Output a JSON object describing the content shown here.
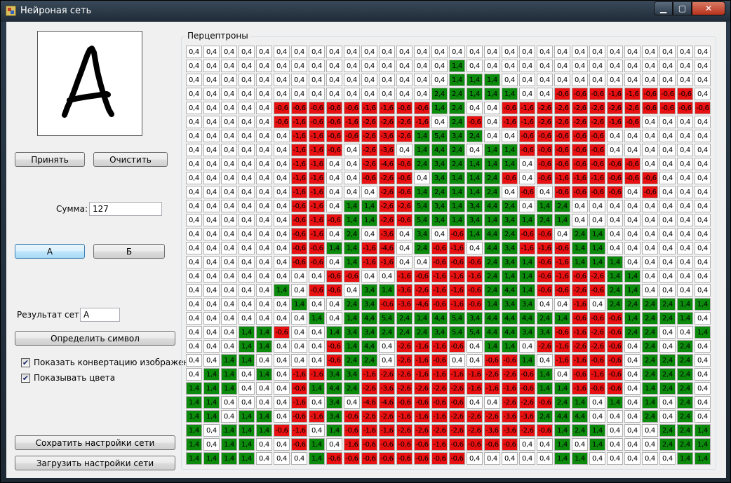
{
  "window": {
    "title": "Нейроная сеть"
  },
  "buttons": {
    "accept": "Принять",
    "clear": "Очистить",
    "letter_a": "А",
    "letter_b": "Б",
    "detect": "Определить символ",
    "save": "Сохратить настройки сети",
    "load": "Загрузить настройки сети"
  },
  "sum": {
    "label": "Сумма:",
    "value": "127"
  },
  "result": {
    "label": "Результат сети:",
    "value": "А"
  },
  "options": {
    "show_conversion": {
      "label": "Показать конвертацию изображения",
      "checked": true
    },
    "show_colors": {
      "label": "Показывать цвета",
      "checked": true
    }
  },
  "perceptrons": {
    "title": "Перцептроны",
    "colors": {
      "w": "#ffffff",
      "g": "#0b8a0b",
      "r": "#e81010"
    },
    "rows": [
      [
        "w:0,4",
        "w:0,4",
        "w:0,4",
        "w:0,4",
        "w:0,4",
        "w:0,4",
        "w:0,4",
        "w:0,4",
        "w:0,4",
        "w:0,4",
        "w:0,4",
        "w:0,4",
        "w:0,4",
        "w:0,4",
        "w:0,4",
        "w:0,4",
        "w:0,4",
        "w:0,4",
        "w:0,4",
        "w:0,4",
        "w:0,4",
        "w:0,4",
        "w:0,4",
        "w:0,4",
        "w:0,4",
        "w:0,4",
        "w:0,4",
        "w:0,4",
        "w:0,4",
        "w:0,4"
      ],
      [
        "w:0,4",
        "w:0,4",
        "w:0,4",
        "w:0,4",
        "w:0,4",
        "w:0,4",
        "w:0,4",
        "w:0,4",
        "w:0,4",
        "w:0,4",
        "w:0,4",
        "w:0,4",
        "w:0,4",
        "w:0,4",
        "w:0,4",
        "g:1,4",
        "w:0,4",
        "w:0,4",
        "w:0,4",
        "w:0,4",
        "w:0,4",
        "w:0,4",
        "w:0,4",
        "w:0,4",
        "w:0,4",
        "w:0,4",
        "w:0,4",
        "w:0,4",
        "w:0,4",
        "w:0,4"
      ],
      [
        "w:0,4",
        "w:0,4",
        "w:0,4",
        "w:0,4",
        "w:0,4",
        "w:0,4",
        "w:0,4",
        "w:0,4",
        "w:0,4",
        "w:0,4",
        "w:0,4",
        "w:0,4",
        "w:0,4",
        "w:0,4",
        "w:0,4",
        "g:1,4",
        "g:1,4",
        "g:1,4",
        "w:0,4",
        "w:0,4",
        "w:0,4",
        "w:0,4",
        "w:0,4",
        "w:0,4",
        "w:0,4",
        "w:0,4",
        "w:0,4",
        "w:0,4",
        "w:0,4",
        "w:0,4"
      ],
      [
        "w:0,4",
        "w:0,4",
        "w:0,4",
        "w:0,4",
        "w:0,4",
        "w:0,4",
        "w:0,4",
        "w:0,4",
        "w:0,4",
        "w:0,4",
        "w:0,4",
        "w:0,4",
        "w:0,4",
        "w:0,4",
        "g:2,4",
        "g:2,4",
        "g:1,4",
        "g:1,4",
        "g:1,4",
        "w:0,4",
        "w:0,4",
        "r:-0,6",
        "r:-0,6",
        "r:-0,6",
        "r:-1,6",
        "r:-1,6",
        "r:-0,6",
        "r:-0,6",
        "r:-0,6",
        "w:0,4"
      ],
      [
        "w:0,4",
        "w:0,4",
        "w:0,4",
        "w:0,4",
        "w:0,4",
        "r:-0,6",
        "r:-0,6",
        "r:-0,6",
        "r:-0,6",
        "r:-0,6",
        "r:-1,6",
        "r:-1,6",
        "r:-0,6",
        "r:-0,6",
        "g:1,4",
        "g:2,4",
        "w:0,4",
        "w:0,4",
        "r:-0,6",
        "r:-1,6",
        "r:-2,6",
        "r:-2,6",
        "r:-2,6",
        "r:-2,6",
        "r:-2,6",
        "r:-2,6",
        "r:-0,6",
        "r:-0,6",
        "r:-0,6",
        "r:-0,6"
      ],
      [
        "w:0,4",
        "w:0,4",
        "w:0,4",
        "w:0,4",
        "w:0,4",
        "r:-0,6",
        "r:-1,6",
        "r:-0,6",
        "r:-0,6",
        "r:-1,6",
        "r:-2,6",
        "r:-2,6",
        "r:-2,6",
        "r:-1,6",
        "w:0,4",
        "g:2,4",
        "r:-0,6",
        "w:0,4",
        "r:-1,6",
        "r:-1,6",
        "r:-2,6",
        "r:-2,6",
        "r:-2,6",
        "r:-2,6",
        "r:-1,6",
        "r:-0,6",
        "w:0,4",
        "w:0,4",
        "w:0,4",
        "w:0,4"
      ],
      [
        "w:0,4",
        "w:0,4",
        "w:0,4",
        "w:0,4",
        "w:0,4",
        "w:0,4",
        "r:-1,6",
        "r:-1,6",
        "r:-0,6",
        "r:-0,6",
        "r:-2,6",
        "r:-3,6",
        "r:-2,6",
        "g:1,4",
        "g:5,4",
        "g:3,4",
        "g:2,4",
        "w:0,4",
        "w:0,4",
        "r:-0,6",
        "r:-0,6",
        "r:-0,6",
        "r:-0,6",
        "r:-0,6",
        "w:0,4",
        "w:0,4",
        "w:0,4",
        "w:0,4",
        "w:0,4",
        "w:0,4"
      ],
      [
        "w:0,4",
        "w:0,4",
        "w:0,4",
        "w:0,4",
        "w:0,4",
        "w:0,4",
        "r:-1,6",
        "r:-1,6",
        "r:-0,6",
        "w:0,4",
        "r:-2,6",
        "r:-3,6",
        "w:0,4",
        "g:1,4",
        "g:4,4",
        "g:2,4",
        "w:0,4",
        "g:1,4",
        "g:1,4",
        "r:-0,6",
        "r:-0,6",
        "r:-0,6",
        "r:-0,6",
        "r:-0,6",
        "w:0,4",
        "w:0,4",
        "w:0,4",
        "w:0,4",
        "w:0,4",
        "w:0,4"
      ],
      [
        "w:0,4",
        "w:0,4",
        "w:0,4",
        "w:0,4",
        "w:0,4",
        "w:0,4",
        "r:-1,6",
        "r:-1,6",
        "w:0,4",
        "w:0,4",
        "r:-2,6",
        "r:-4,6",
        "r:-0,6",
        "g:2,4",
        "g:3,4",
        "g:2,4",
        "g:1,4",
        "g:1,4",
        "g:1,4",
        "w:0,4",
        "r:-0,6",
        "r:-0,6",
        "r:-0,6",
        "r:-0,6",
        "r:-0,6",
        "r:-0,6",
        "w:0,4",
        "w:0,4",
        "w:0,4",
        "w:0,4"
      ],
      [
        "w:0,4",
        "w:0,4",
        "w:0,4",
        "w:0,4",
        "w:0,4",
        "w:0,4",
        "r:-1,6",
        "r:-1,6",
        "w:0,4",
        "w:0,4",
        "r:-0,6",
        "r:-2,6",
        "r:-0,6",
        "w:0,4",
        "g:3,4",
        "g:1,4",
        "g:1,4",
        "g:2,4",
        "r:-0,6",
        "w:0,4",
        "r:-0,6",
        "r:-1,6",
        "r:-1,6",
        "r:-1,6",
        "r:-0,6",
        "r:-0,6",
        "r:-0,6",
        "w:0,4",
        "w:0,4",
        "w:0,4"
      ],
      [
        "w:0,4",
        "w:0,4",
        "w:0,4",
        "w:0,4",
        "w:0,4",
        "w:0,4",
        "r:-1,6",
        "r:-1,6",
        "w:0,4",
        "w:0,4",
        "w:0,4",
        "r:-2,6",
        "r:-0,6",
        "g:1,4",
        "g:2,4",
        "g:1,4",
        "g:1,4",
        "g:2,4",
        "w:0,4",
        "r:-0,6",
        "w:0,4",
        "r:-0,6",
        "r:-0,6",
        "r:-0,6",
        "r:-0,6",
        "w:0,4",
        "r:-0,6",
        "w:0,4",
        "w:0,4",
        "w:0,4"
      ],
      [
        "w:0,4",
        "w:0,4",
        "w:0,4",
        "w:0,4",
        "w:0,4",
        "w:0,4",
        "r:-0,6",
        "r:-1,6",
        "w:0,4",
        "g:1,4",
        "g:1,4",
        "r:-2,6",
        "r:-2,6",
        "g:5,4",
        "g:3,4",
        "g:1,4",
        "g:3,4",
        "g:4,4",
        "g:2,4",
        "w:0,4",
        "g:1,4",
        "g:2,4",
        "w:0,4",
        "w:0,4",
        "w:0,4",
        "w:0,4",
        "w:0,4",
        "w:0,4",
        "w:0,4",
        "w:0,4"
      ],
      [
        "w:0,4",
        "w:0,4",
        "w:0,4",
        "w:0,4",
        "w:0,4",
        "w:0,4",
        "r:-0,6",
        "r:-1,6",
        "r:-0,6",
        "g:1,4",
        "g:1,4",
        "r:-2,6",
        "r:-0,6",
        "g:5,4",
        "g:3,4",
        "g:1,4",
        "g:3,4",
        "g:1,4",
        "g:3,4",
        "g:1,4",
        "g:2,4",
        "g:1,4",
        "w:0,4",
        "w:0,4",
        "w:0,4",
        "w:0,4",
        "w:0,4",
        "w:0,4",
        "w:0,4",
        "w:0,4"
      ],
      [
        "w:0,4",
        "w:0,4",
        "w:0,4",
        "w:0,4",
        "w:0,4",
        "w:0,4",
        "r:-0,6",
        "r:-1,6",
        "w:0,4",
        "g:2,4",
        "w:0,4",
        "r:-3,6",
        "w:0,4",
        "g:3,4",
        "w:0,4",
        "r:-0,6",
        "g:1,4",
        "g:4,4",
        "g:2,4",
        "r:-0,6",
        "r:-0,6",
        "w:0,4",
        "g:2,4",
        "g:1,4",
        "w:0,4",
        "w:0,4",
        "w:0,4",
        "w:0,4",
        "w:0,4",
        "w:0,4"
      ],
      [
        "w:0,4",
        "w:0,4",
        "w:0,4",
        "w:0,4",
        "w:0,4",
        "w:0,4",
        "r:-0,6",
        "r:-0,6",
        "g:1,4",
        "g:1,4",
        "r:-1,6",
        "r:-4,6",
        "w:0,4",
        "g:2,4",
        "r:-0,6",
        "r:-1,6",
        "w:0,4",
        "g:4,4",
        "g:3,4",
        "r:-1,6",
        "r:-1,6",
        "r:-0,6",
        "g:1,4",
        "g:1,4",
        "w:0,4",
        "w:0,4",
        "w:0,4",
        "w:0,4",
        "w:0,4",
        "w:0,4"
      ],
      [
        "w:0,4",
        "w:0,4",
        "w:0,4",
        "w:0,4",
        "w:0,4",
        "w:0,4",
        "r:-0,6",
        "r:-0,6",
        "w:0,4",
        "g:1,4",
        "r:-1,6",
        "r:-1,6",
        "w:0,4",
        "w:0,4",
        "r:-0,6",
        "r:-0,6",
        "r:-0,6",
        "g:2,4",
        "g:3,4",
        "g:1,4",
        "r:-0,6",
        "r:-1,6",
        "g:1,4",
        "g:1,4",
        "g:1,4",
        "w:0,4",
        "w:0,4",
        "w:0,4",
        "w:0,4",
        "w:0,4"
      ],
      [
        "w:0,4",
        "w:0,4",
        "w:0,4",
        "w:0,4",
        "w:0,4",
        "w:0,4",
        "w:0,4",
        "w:0,4",
        "r:-0,6",
        "r:-0,6",
        "w:0,4",
        "w:0,4",
        "r:-1,6",
        "r:-0,6",
        "r:-1,6",
        "r:-1,6",
        "r:-1,6",
        "g:2,4",
        "g:1,4",
        "g:1,4",
        "r:-0,6",
        "r:-1,6",
        "r:-0,6",
        "r:-2,6",
        "g:1,4",
        "g:1,4",
        "w:0,4",
        "w:0,4",
        "w:0,4",
        "w:0,4"
      ],
      [
        "w:0,4",
        "w:0,4",
        "w:0,4",
        "w:0,4",
        "w:0,4",
        "g:1,4",
        "w:0,4",
        "r:-0,6",
        "r:-0,6",
        "w:0,4",
        "g:3,4",
        "g:1,4",
        "r:-3,6",
        "r:-2,6",
        "r:-1,6",
        "r:-1,6",
        "r:-0,6",
        "g:2,4",
        "g:4,4",
        "g:1,4",
        "r:-0,6",
        "r:-0,6",
        "r:-2,6",
        "r:-0,6",
        "g:2,4",
        "g:1,4",
        "w:0,4",
        "w:0,4",
        "w:0,4",
        "w:0,4"
      ],
      [
        "w:0,4",
        "w:0,4",
        "w:0,4",
        "w:0,4",
        "w:0,4",
        "w:0,4",
        "g:1,4",
        "w:0,4",
        "w:0,4",
        "g:2,4",
        "g:3,4",
        "r:-0,6",
        "r:-3,6",
        "r:-4,6",
        "r:-0,6",
        "r:-1,6",
        "r:-0,6",
        "g:1,4",
        "g:3,4",
        "g:3,4",
        "w:0,4",
        "w:0,4",
        "r:-1,6",
        "w:0,4",
        "g:2,4",
        "g:2,4",
        "g:2,4",
        "g:2,4",
        "g:1,4",
        "g:1,4"
      ],
      [
        "w:0,4",
        "w:0,4",
        "w:0,4",
        "w:0,4",
        "w:0,4",
        "w:0,4",
        "w:0,4",
        "g:1,4",
        "w:0,4",
        "g:1,4",
        "g:4,4",
        "g:5,4",
        "g:2,4",
        "g:1,4",
        "g:4,4",
        "g:5,4",
        "g:3,4",
        "g:4,4",
        "g:4,4",
        "g:4,4",
        "g:2,4",
        "g:1,4",
        "r:-0,6",
        "r:-0,6",
        "r:-0,6",
        "g:1,4",
        "g:2,4",
        "g:2,4",
        "g:1,4",
        "w:0,4"
      ],
      [
        "w:0,4",
        "w:0,4",
        "w:0,4",
        "g:1,4",
        "g:1,4",
        "r:-0,6",
        "w:0,4",
        "w:0,4",
        "g:1,4",
        "g:3,4",
        "g:3,4",
        "g:2,4",
        "g:2,4",
        "g:2,4",
        "g:3,4",
        "g:5,4",
        "g:5,4",
        "g:4,4",
        "g:4,4",
        "g:3,4",
        "g:3,4",
        "r:-0,6",
        "r:-1,6",
        "r:-2,6",
        "r:-0,6",
        "g:2,4",
        "g:2,4",
        "w:0,4",
        "w:0,4",
        "g:1,4"
      ],
      [
        "w:0,4",
        "w:0,4",
        "w:0,4",
        "g:1,4",
        "g:1,4",
        "w:0,4",
        "w:0,4",
        "w:0,4",
        "r:-0,6",
        "g:1,4",
        "g:4,4",
        "w:0,4",
        "r:-2,6",
        "r:-1,6",
        "r:-1,6",
        "r:-0,6",
        "w:0,4",
        "g:1,4",
        "g:1,4",
        "w:0,4",
        "r:-2,6",
        "r:-1,6",
        "r:-2,6",
        "r:-2,6",
        "r:-0,6",
        "w:0,4",
        "g:2,4",
        "w:0,4",
        "g:2,4",
        "w:0,4"
      ],
      [
        "w:0,4",
        "w:0,4",
        "g:1,4",
        "g:1,4",
        "w:0,4",
        "w:0,4",
        "w:0,4",
        "w:0,4",
        "r:-0,6",
        "g:2,4",
        "g:2,4",
        "w:0,4",
        "r:-2,6",
        "r:-1,6",
        "r:-0,6",
        "w:0,4",
        "w:0,4",
        "r:-0,6",
        "r:-0,6",
        "g:1,4",
        "w:0,4",
        "r:-1,6",
        "r:-1,6",
        "r:-0,6",
        "r:-0,6",
        "w:0,4",
        "g:2,4",
        "g:2,4",
        "g:2,4",
        "w:0,4"
      ],
      [
        "w:0,4",
        "g:1,4",
        "g:1,4",
        "w:0,4",
        "g:1,4",
        "w:0,4",
        "r:-1,6",
        "r:-1,6",
        "g:3,4",
        "g:3,4",
        "r:-1,6",
        "r:-2,6",
        "r:-2,6",
        "r:-1,6",
        "r:-1,6",
        "r:-1,6",
        "r:-1,6",
        "r:-2,6",
        "r:-2,6",
        "r:-0,6",
        "g:1,4",
        "w:0,4",
        "r:-0,6",
        "r:-1,6",
        "r:-0,6",
        "w:0,4",
        "g:2,4",
        "g:2,4",
        "g:2,4",
        "w:0,4"
      ],
      [
        "g:1,4",
        "g:1,4",
        "g:1,4",
        "w:0,4",
        "w:0,4",
        "w:0,4",
        "r:-0,6",
        "g:1,4",
        "g:4,4",
        "g:2,4",
        "r:-2,6",
        "r:-3,6",
        "r:-2,6",
        "r:-2,6",
        "r:-2,6",
        "r:-2,6",
        "r:-1,6",
        "r:-1,6",
        "r:-1,6",
        "r:-0,6",
        "g:1,4",
        "g:1,4",
        "r:-1,6",
        "r:-0,6",
        "r:-0,6",
        "w:0,4",
        "g:1,4",
        "g:2,4",
        "g:2,4",
        "w:0,4"
      ],
      [
        "g:1,4",
        "g:1,4",
        "w:0,4",
        "w:0,4",
        "w:0,4",
        "w:0,4",
        "r:-1,6",
        "w:0,4",
        "g:3,4",
        "w:0,4",
        "r:-4,6",
        "r:-4,6",
        "r:-0,6",
        "r:-0,6",
        "r:-0,6",
        "r:-0,6",
        "w:0,4",
        "w:0,4",
        "r:-2,6",
        "r:-2,6",
        "r:-0,6",
        "g:2,4",
        "g:1,4",
        "w:0,4",
        "g:1,4",
        "w:0,4",
        "g:1,4",
        "w:0,4",
        "g:2,4",
        "w:0,4"
      ],
      [
        "g:1,4",
        "g:1,4",
        "w:0,4",
        "g:1,4",
        "g:1,4",
        "w:0,4",
        "r:-0,6",
        "r:-1,6",
        "g:3,4",
        "r:-0,6",
        "r:-2,6",
        "r:-2,6",
        "r:-1,6",
        "r:-1,6",
        "r:-1,6",
        "r:-2,6",
        "r:-2,6",
        "r:-2,6",
        "r:-3,6",
        "r:-3,6",
        "g:2,4",
        "g:4,4",
        "g:4,4",
        "w:0,4",
        "w:0,4",
        "w:0,4",
        "g:2,4",
        "w:0,4",
        "g:2,4",
        "w:0,4"
      ],
      [
        "g:1,4",
        "w:0,4",
        "g:1,4",
        "g:1,4",
        "g:1,4",
        "r:-0,6",
        "r:-1,6",
        "w:0,4",
        "g:1,4",
        "r:-0,6",
        "r:-1,6",
        "r:-1,6",
        "r:-2,6",
        "r:-2,6",
        "r:-2,6",
        "r:-2,6",
        "r:-2,6",
        "r:-3,6",
        "r:-3,6",
        "r:-2,6",
        "r:-0,6",
        "g:1,4",
        "g:2,4",
        "g:1,4",
        "w:0,4",
        "w:0,4",
        "w:0,4",
        "g:2,4",
        "g:2,4",
        "g:1,4"
      ],
      [
        "g:1,4",
        "w:0,4",
        "g:1,4",
        "g:1,4",
        "w:0,4",
        "w:0,4",
        "r:-0,6",
        "g:1,4",
        "w:0,4",
        "r:-1,6",
        "r:-0,6",
        "r:-0,6",
        "r:-0,6",
        "r:-0,6",
        "r:-1,6",
        "r:-0,6",
        "r:-0,6",
        "r:-0,6",
        "r:-0,6",
        "w:0,4",
        "w:0,4",
        "g:1,4",
        "w:0,4",
        "g:1,4",
        "w:0,4",
        "w:0,4",
        "w:0,4",
        "g:2,4",
        "g:2,4",
        "g:1,4"
      ],
      [
        "g:1,4",
        "g:1,4",
        "g:1,4",
        "g:1,4",
        "w:0,4",
        "w:0,4",
        "w:0,4",
        "g:1,4",
        "r:-0,6",
        "r:-0,6",
        "r:-0,6",
        "r:-0,6",
        "r:-0,6",
        "r:-0,6",
        "r:-0,6",
        "r:-0,6",
        "w:0,4",
        "w:0,4",
        "w:0,4",
        "w:0,4",
        "w:0,4",
        "g:1,4",
        "g:1,4",
        "w:0,4",
        "w:0,4",
        "w:0,4",
        "w:0,4",
        "w:0,4",
        "g:1,4",
        "g:1,4"
      ]
    ]
  }
}
